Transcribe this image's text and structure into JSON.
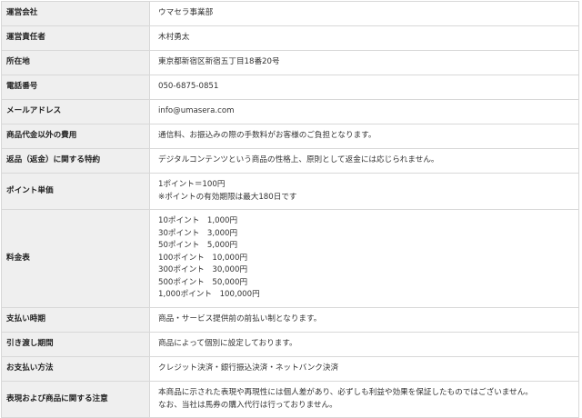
{
  "rows": [
    {
      "label": "運営会社",
      "lines": [
        "ウマセラ事業部"
      ]
    },
    {
      "label": "運営責任者",
      "lines": [
        "木村勇太"
      ]
    },
    {
      "label": "所在地",
      "lines": [
        "東京都新宿区新宿五丁目18番20号"
      ]
    },
    {
      "label": "電話番号",
      "lines": [
        "050-6875-0851"
      ]
    },
    {
      "label": "メールアドレス",
      "lines": [
        "info@umasera.com"
      ]
    },
    {
      "label": "商品代金以外の費用",
      "lines": [
        "通信料、お振込みの際の手数料がお客様のご負担となります。"
      ]
    },
    {
      "label": "返品（返金）に関する特約",
      "lines": [
        "デジタルコンテンツという商品の性格上、原則として返金には応じられません。"
      ]
    },
    {
      "label": "ポイント単価",
      "lines": [
        "1ポイント＝100円",
        "※ポイントの有効期限は最大180日です"
      ]
    },
    {
      "label": "料金表",
      "lines": [
        "10ポイント　1,000円",
        "30ポイント　3,000円",
        "50ポイント　5,000円",
        "100ポイント　10,000円",
        "300ポイント　30,000円",
        "500ポイント　50,000円",
        "1,000ポイント　100,000円"
      ]
    },
    {
      "label": "支払い時期",
      "lines": [
        "商品・サービス提供前の前払い制となります。"
      ]
    },
    {
      "label": "引き渡し期間",
      "lines": [
        "商品によって個別に設定しております。"
      ]
    },
    {
      "label": "お支払い方法",
      "lines": [
        "クレジット決済・銀行振込決済・ネットバンク決済"
      ]
    },
    {
      "label": "表現および商品に関する注意",
      "lines": [
        "本商品に示された表現や再現性には個人差があり、必ずしも利益や効果を保証したものではございません。",
        "なお、当社は馬券の購入代行は行っておりません。"
      ]
    }
  ]
}
